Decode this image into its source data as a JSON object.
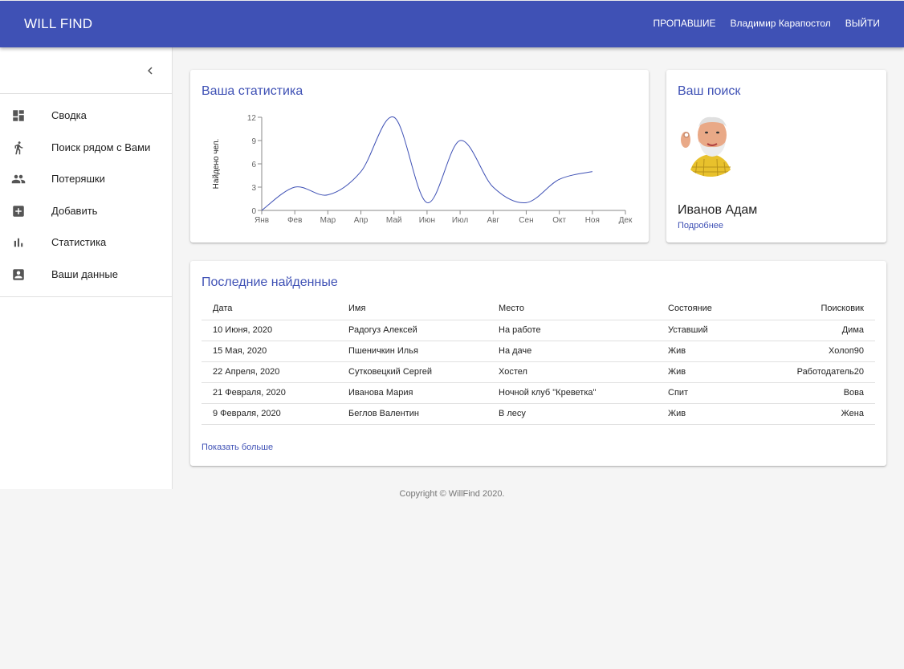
{
  "header": {
    "brand": "WILL FIND",
    "nav": [
      "ПРОПАВШИЕ",
      "Владимир Карапостол",
      "ВЫЙТИ"
    ]
  },
  "sidebar": {
    "items": [
      {
        "label": "Сводка",
        "icon": "dashboard-icon"
      },
      {
        "label": "Поиск рядом с Вами",
        "icon": "walk-icon"
      },
      {
        "label": "Потеряшки",
        "icon": "people-icon"
      },
      {
        "label": "Добавить",
        "icon": "add-box-icon"
      },
      {
        "label": "Статистика",
        "icon": "bar-chart-icon"
      },
      {
        "label": "Ваши данные",
        "icon": "account-box-icon"
      }
    ]
  },
  "stats": {
    "title": "Ваша статистика"
  },
  "chart_data": {
    "type": "line",
    "categories": [
      "Янв",
      "Фев",
      "Мар",
      "Апр",
      "Май",
      "Июн",
      "Июл",
      "Авг",
      "Сен",
      "Окт",
      "Ноя",
      "Дек"
    ],
    "series": [
      {
        "values": [
          0,
          3,
          2,
          5,
          12,
          1,
          9,
          3,
          1,
          4,
          5
        ]
      }
    ],
    "ylabel": "Найдено чел.",
    "yticks": [
      0,
      3,
      6,
      9,
      12
    ],
    "ylim": [
      0,
      12
    ],
    "grid": false,
    "color": "#3f51b5"
  },
  "search": {
    "title": "Ваш поиск",
    "name": "Иванов Адам",
    "link": "Подробнее"
  },
  "recent": {
    "title": "Последние найденные",
    "columns": [
      "Дата",
      "Имя",
      "Место",
      "Состояние",
      "Поисковик"
    ],
    "rows": [
      [
        "10 Июня, 2020",
        "Радогуз Алексей",
        "На работе",
        "Уставший",
        "Дима"
      ],
      [
        "15 Мая, 2020",
        "Пшеничкин Илья",
        "На даче",
        "Жив",
        "Холоп90"
      ],
      [
        "22 Апреля, 2020",
        "Сутковецкий Сергей",
        "Хостел",
        "Жив",
        "Работодатель20"
      ],
      [
        "21 Февраля, 2020",
        "Иванова Мария",
        "Ночной клуб \"Креветка\"",
        "Спит",
        "Вова"
      ],
      [
        "9 Февраля, 2020",
        "Беглов Валентин",
        "В лесу",
        "Жив",
        "Жена"
      ]
    ],
    "show_more": "Показать больше"
  },
  "footer": {
    "copyright": "Copyright © WillFind 2020."
  },
  "colors": {
    "primary": "#3f51b5",
    "icon": "#555555"
  }
}
